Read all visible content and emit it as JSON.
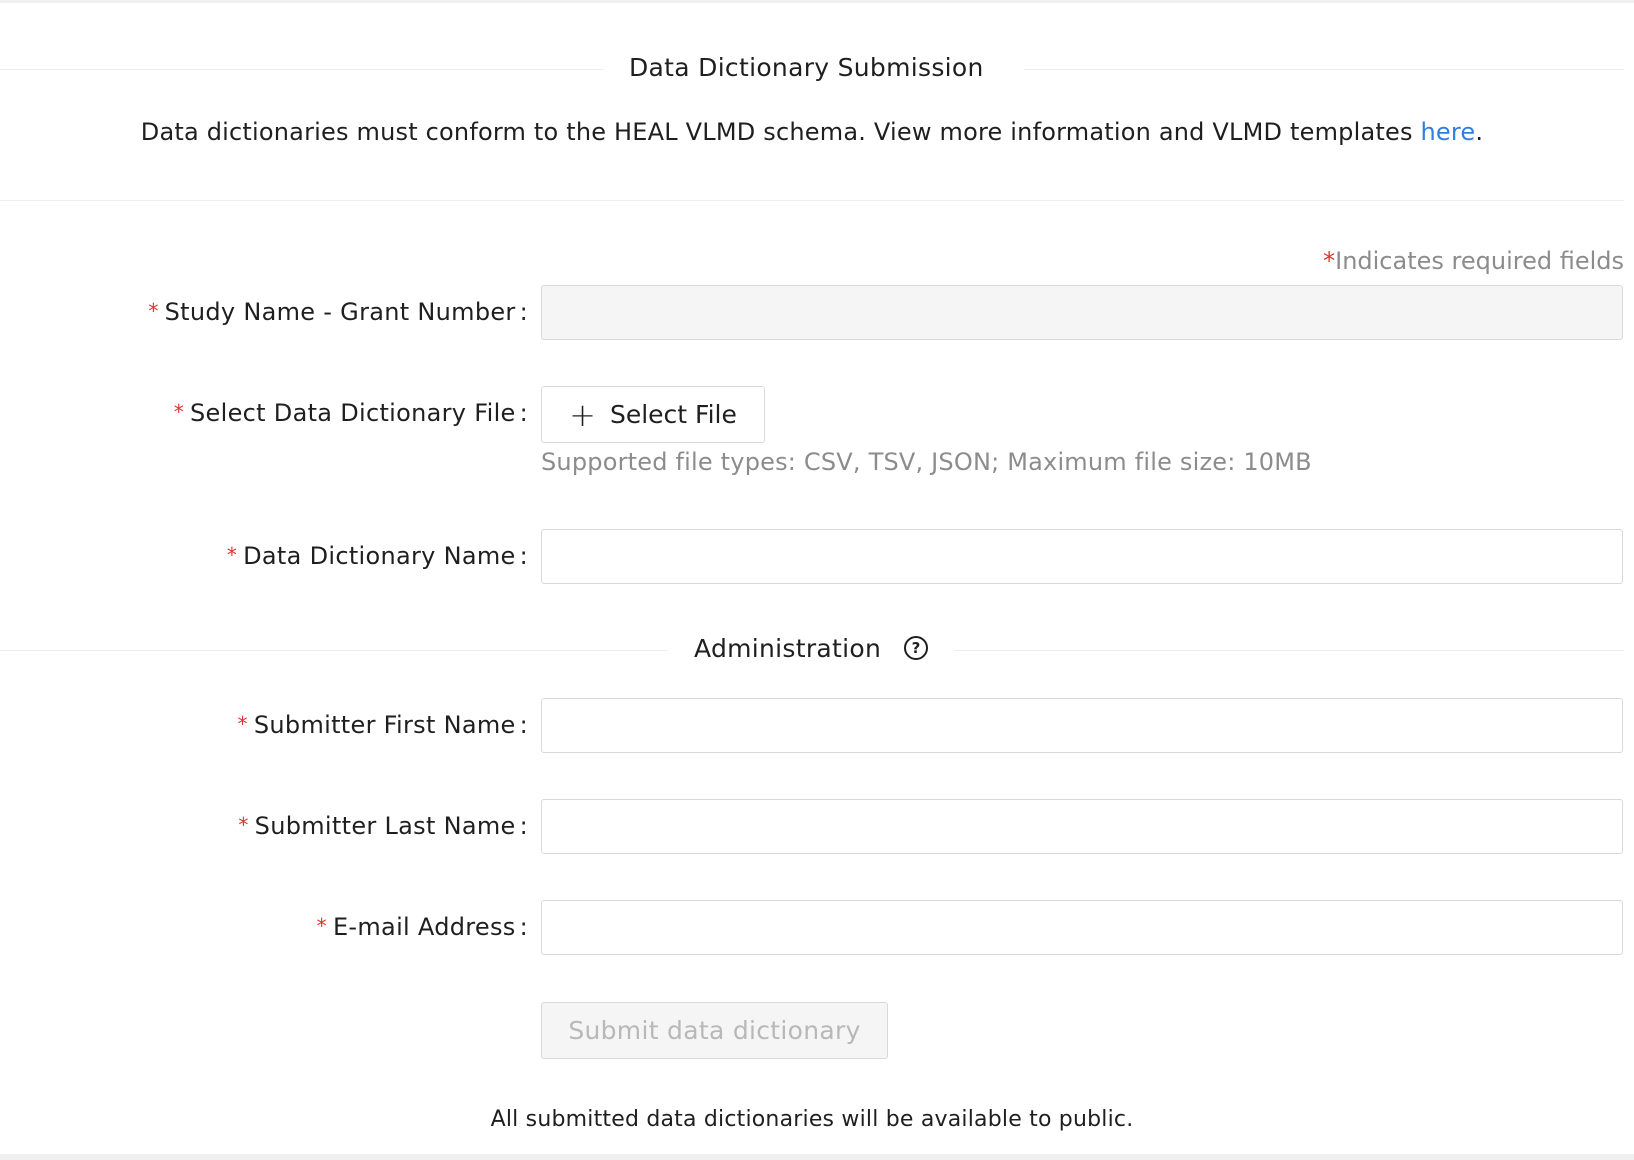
{
  "header": {
    "title": "Data Dictionary Submission",
    "intro_text": "Data dictionaries must conform to the HEAL VLMD schema. View more information and VLMD templates ",
    "intro_link": "here",
    "intro_end": "."
  },
  "required_note": {
    "star": "*",
    "text": "Indicates required fields"
  },
  "form": {
    "study_name": {
      "label": "Study Name - Grant Number",
      "value": ""
    },
    "file": {
      "label": "Select Data Dictionary File",
      "button_label": "Select File",
      "hint": "Supported file types: CSV, TSV, JSON; Maximum file size: 10MB"
    },
    "dictionary_name": {
      "label": "Data Dictionary Name",
      "value": ""
    },
    "administration": {
      "title": "Administration",
      "help_icon": "question-circle-icon"
    },
    "first_name": {
      "label": "Submitter First Name",
      "value": ""
    },
    "last_name": {
      "label": "Submitter Last Name",
      "value": ""
    },
    "email": {
      "label": "E-mail Address",
      "value": ""
    },
    "submit_label": "Submit data dictionary"
  },
  "footer": {
    "note": "All submitted data dictionaries will be available to public."
  },
  "colors": {
    "required_star": "#e0322f",
    "link": "#2f7fe0",
    "muted_text": "#8c8c8c",
    "disabled_bg": "#f5f5f5"
  }
}
